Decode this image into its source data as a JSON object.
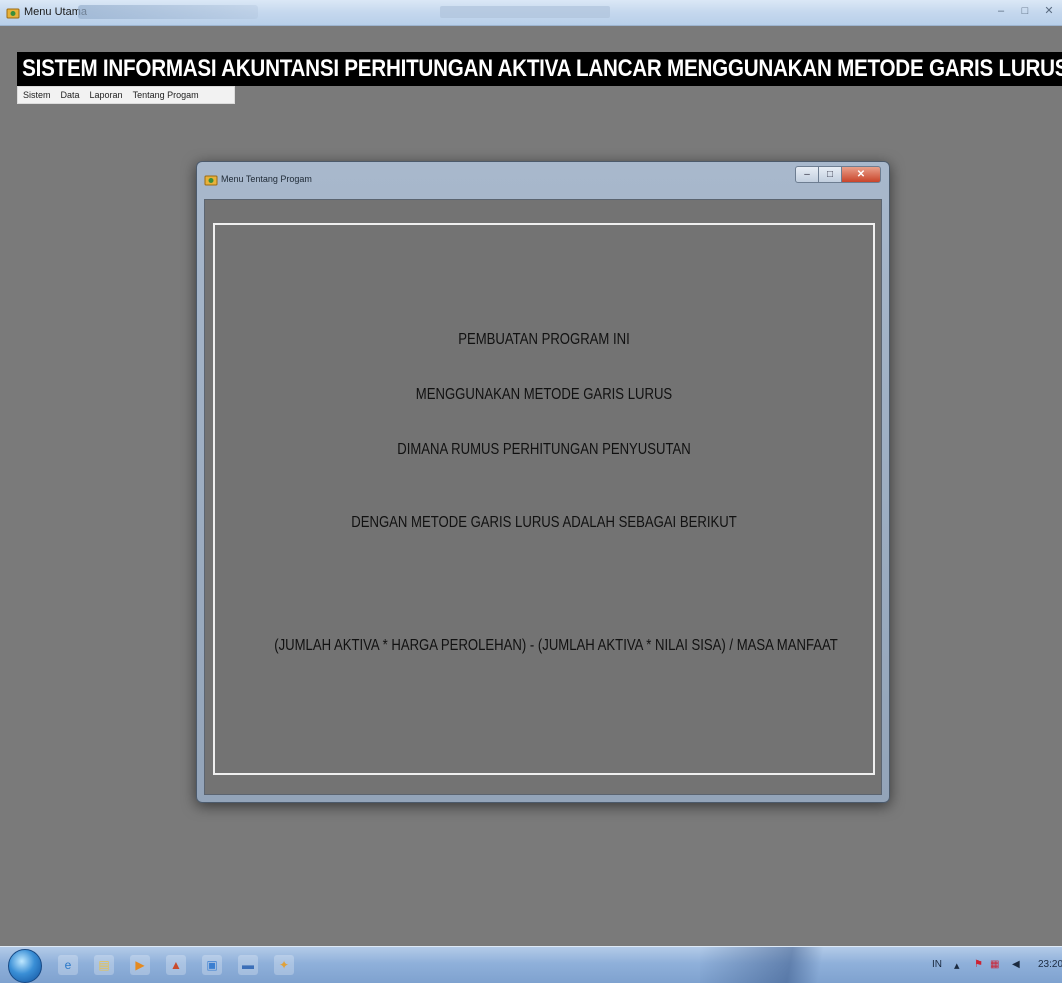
{
  "main_window": {
    "title": "Menu Utama",
    "controls": {
      "minimize": "–",
      "maximize": "□",
      "close": "✕"
    }
  },
  "banner": {
    "text": "SISTEM INFORMASI AKUNTANSI PERHITUNGAN AKTIVA LANCAR MENGGUNAKAN METODE GARIS LURUS"
  },
  "menubar": {
    "items": [
      {
        "label": "Sistem"
      },
      {
        "label": "Data"
      },
      {
        "label": "Laporan"
      },
      {
        "label": "Tentang Progam"
      }
    ]
  },
  "child_window": {
    "title": "Menu Tentang Progam",
    "controls": {
      "minimize": "–",
      "maximize": "□",
      "close": "✕"
    },
    "lines": [
      "PEMBUATAN PROGRAM INI",
      "MENGGUNAKAN METODE GARIS LURUS",
      "DIMANA RUMUS PERHITUNGAN PENYUSUTAN",
      "DENGAN METODE GARIS LURUS ADALAH SEBAGAI BERIKUT",
      "(JUMLAH AKTIVA * HARGA PEROLEHAN) - (JUMLAH AKTIVA * NILAI SISA) / MASA MANFAAT"
    ]
  },
  "taskbar": {
    "pinned": [
      {
        "icon": "internet-explorer-icon",
        "glyph": "e",
        "color": "#2a78c8"
      },
      {
        "icon": "explorer-icon",
        "glyph": "▤",
        "color": "#e9c24a"
      },
      {
        "icon": "media-player-icon",
        "glyph": "▶",
        "color": "#e58a1f"
      },
      {
        "icon": "paint-icon",
        "glyph": "▲",
        "color": "#c94b2c"
      },
      {
        "icon": "document-icon",
        "glyph": "▣",
        "color": "#3a7ed0"
      },
      {
        "icon": "folder-icon",
        "glyph": "▬",
        "color": "#3c6fb8"
      },
      {
        "icon": "app-icon",
        "glyph": "✦",
        "color": "#e0a13a"
      }
    ],
    "tray": {
      "language": "IN",
      "clock": "23:20"
    }
  }
}
